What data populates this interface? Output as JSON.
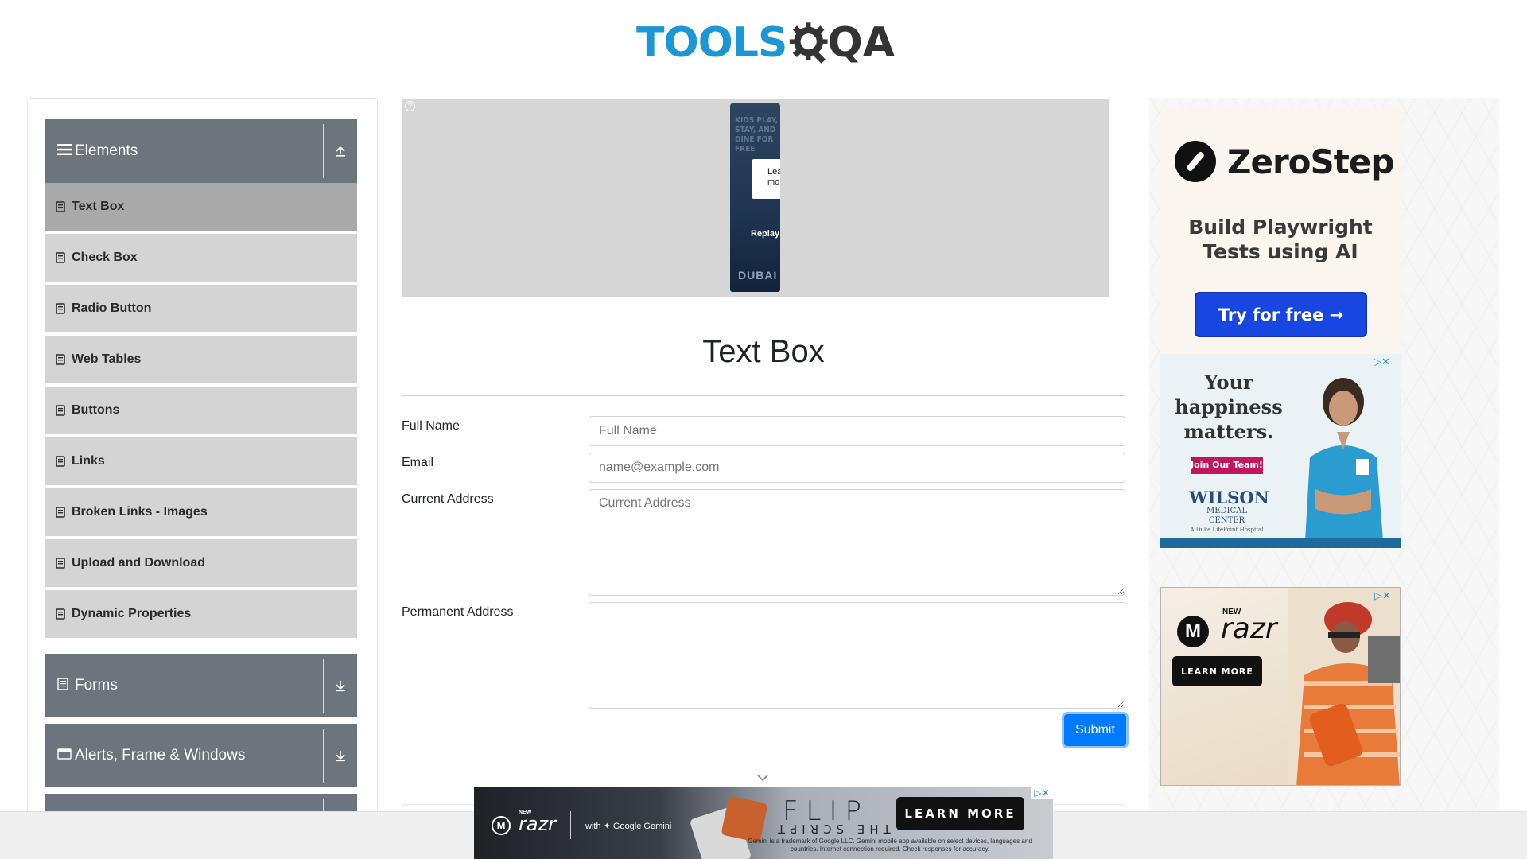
{
  "logo": {
    "part1": "TOOLS",
    "part2": "QA"
  },
  "sidebar": {
    "elements_group": {
      "label": "Elements",
      "icon": "hamburger-icon"
    },
    "items": [
      {
        "label": "Text Box"
      },
      {
        "label": "Check Box"
      },
      {
        "label": "Radio Button"
      },
      {
        "label": "Web Tables"
      },
      {
        "label": "Buttons"
      },
      {
        "label": "Links"
      },
      {
        "label": "Broken Links - Images"
      },
      {
        "label": "Upload and Download"
      },
      {
        "label": "Dynamic Properties"
      }
    ],
    "forms_group": {
      "label": "Forms"
    },
    "alerts_group": {
      "label": "Alerts, Frame & Windows"
    },
    "active_index": 0
  },
  "ad_top": {
    "headline": "KIDS PLAY, STAY, AND DINE FOR FREE",
    "card_text": "Lea mo",
    "replay": "Replay",
    "brand": "DUBAI"
  },
  "main": {
    "title": "Text Box",
    "form": {
      "full_name": {
        "label": "Full Name",
        "placeholder": "Full Name",
        "value": ""
      },
      "email": {
        "label": "Email",
        "placeholder": "name@example.com",
        "value": ""
      },
      "current_address": {
        "label": "Current Address",
        "placeholder": "Current Address",
        "value": ""
      },
      "permanent_address": {
        "label": "Permanent Address",
        "placeholder": "",
        "value": ""
      },
      "submit_label": "Submit"
    }
  },
  "ads_right": {
    "zerostep": {
      "name": "ZeroStep",
      "tagline": "Build Playwright Tests using AI",
      "cta": "Try for free →"
    },
    "wilson": {
      "headline": "Your happiness matters.",
      "cta": "Join Our Team!",
      "brand": "WILSON",
      "brand_sub": "MEDICAL CENTER",
      "brand_sub2": "A Duke LifePoint Hospital"
    },
    "razr": {
      "new": "NEW",
      "name": "razr",
      "cta": "LEARN MORE"
    }
  },
  "ad_bottom": {
    "new": "NEW",
    "name": "razr",
    "partner": "with ✦ Google Gemini",
    "headline": "FLIP",
    "subheadline": "THE SCRIPT",
    "fine_print": "Gemini is a trademark of Google LLC. Gemini mobile app available on select devices, languages and countries. Internet connection required. Check responses for accuracy.",
    "cta": "LEARN MORE"
  },
  "colors": {
    "brand_blue": "#1a97d4",
    "sidebar_header": "#6c757d",
    "menu_item_bg": "#d4d4d4",
    "menu_active_bg": "#a9a9a9",
    "primary_button": "#007bff"
  }
}
